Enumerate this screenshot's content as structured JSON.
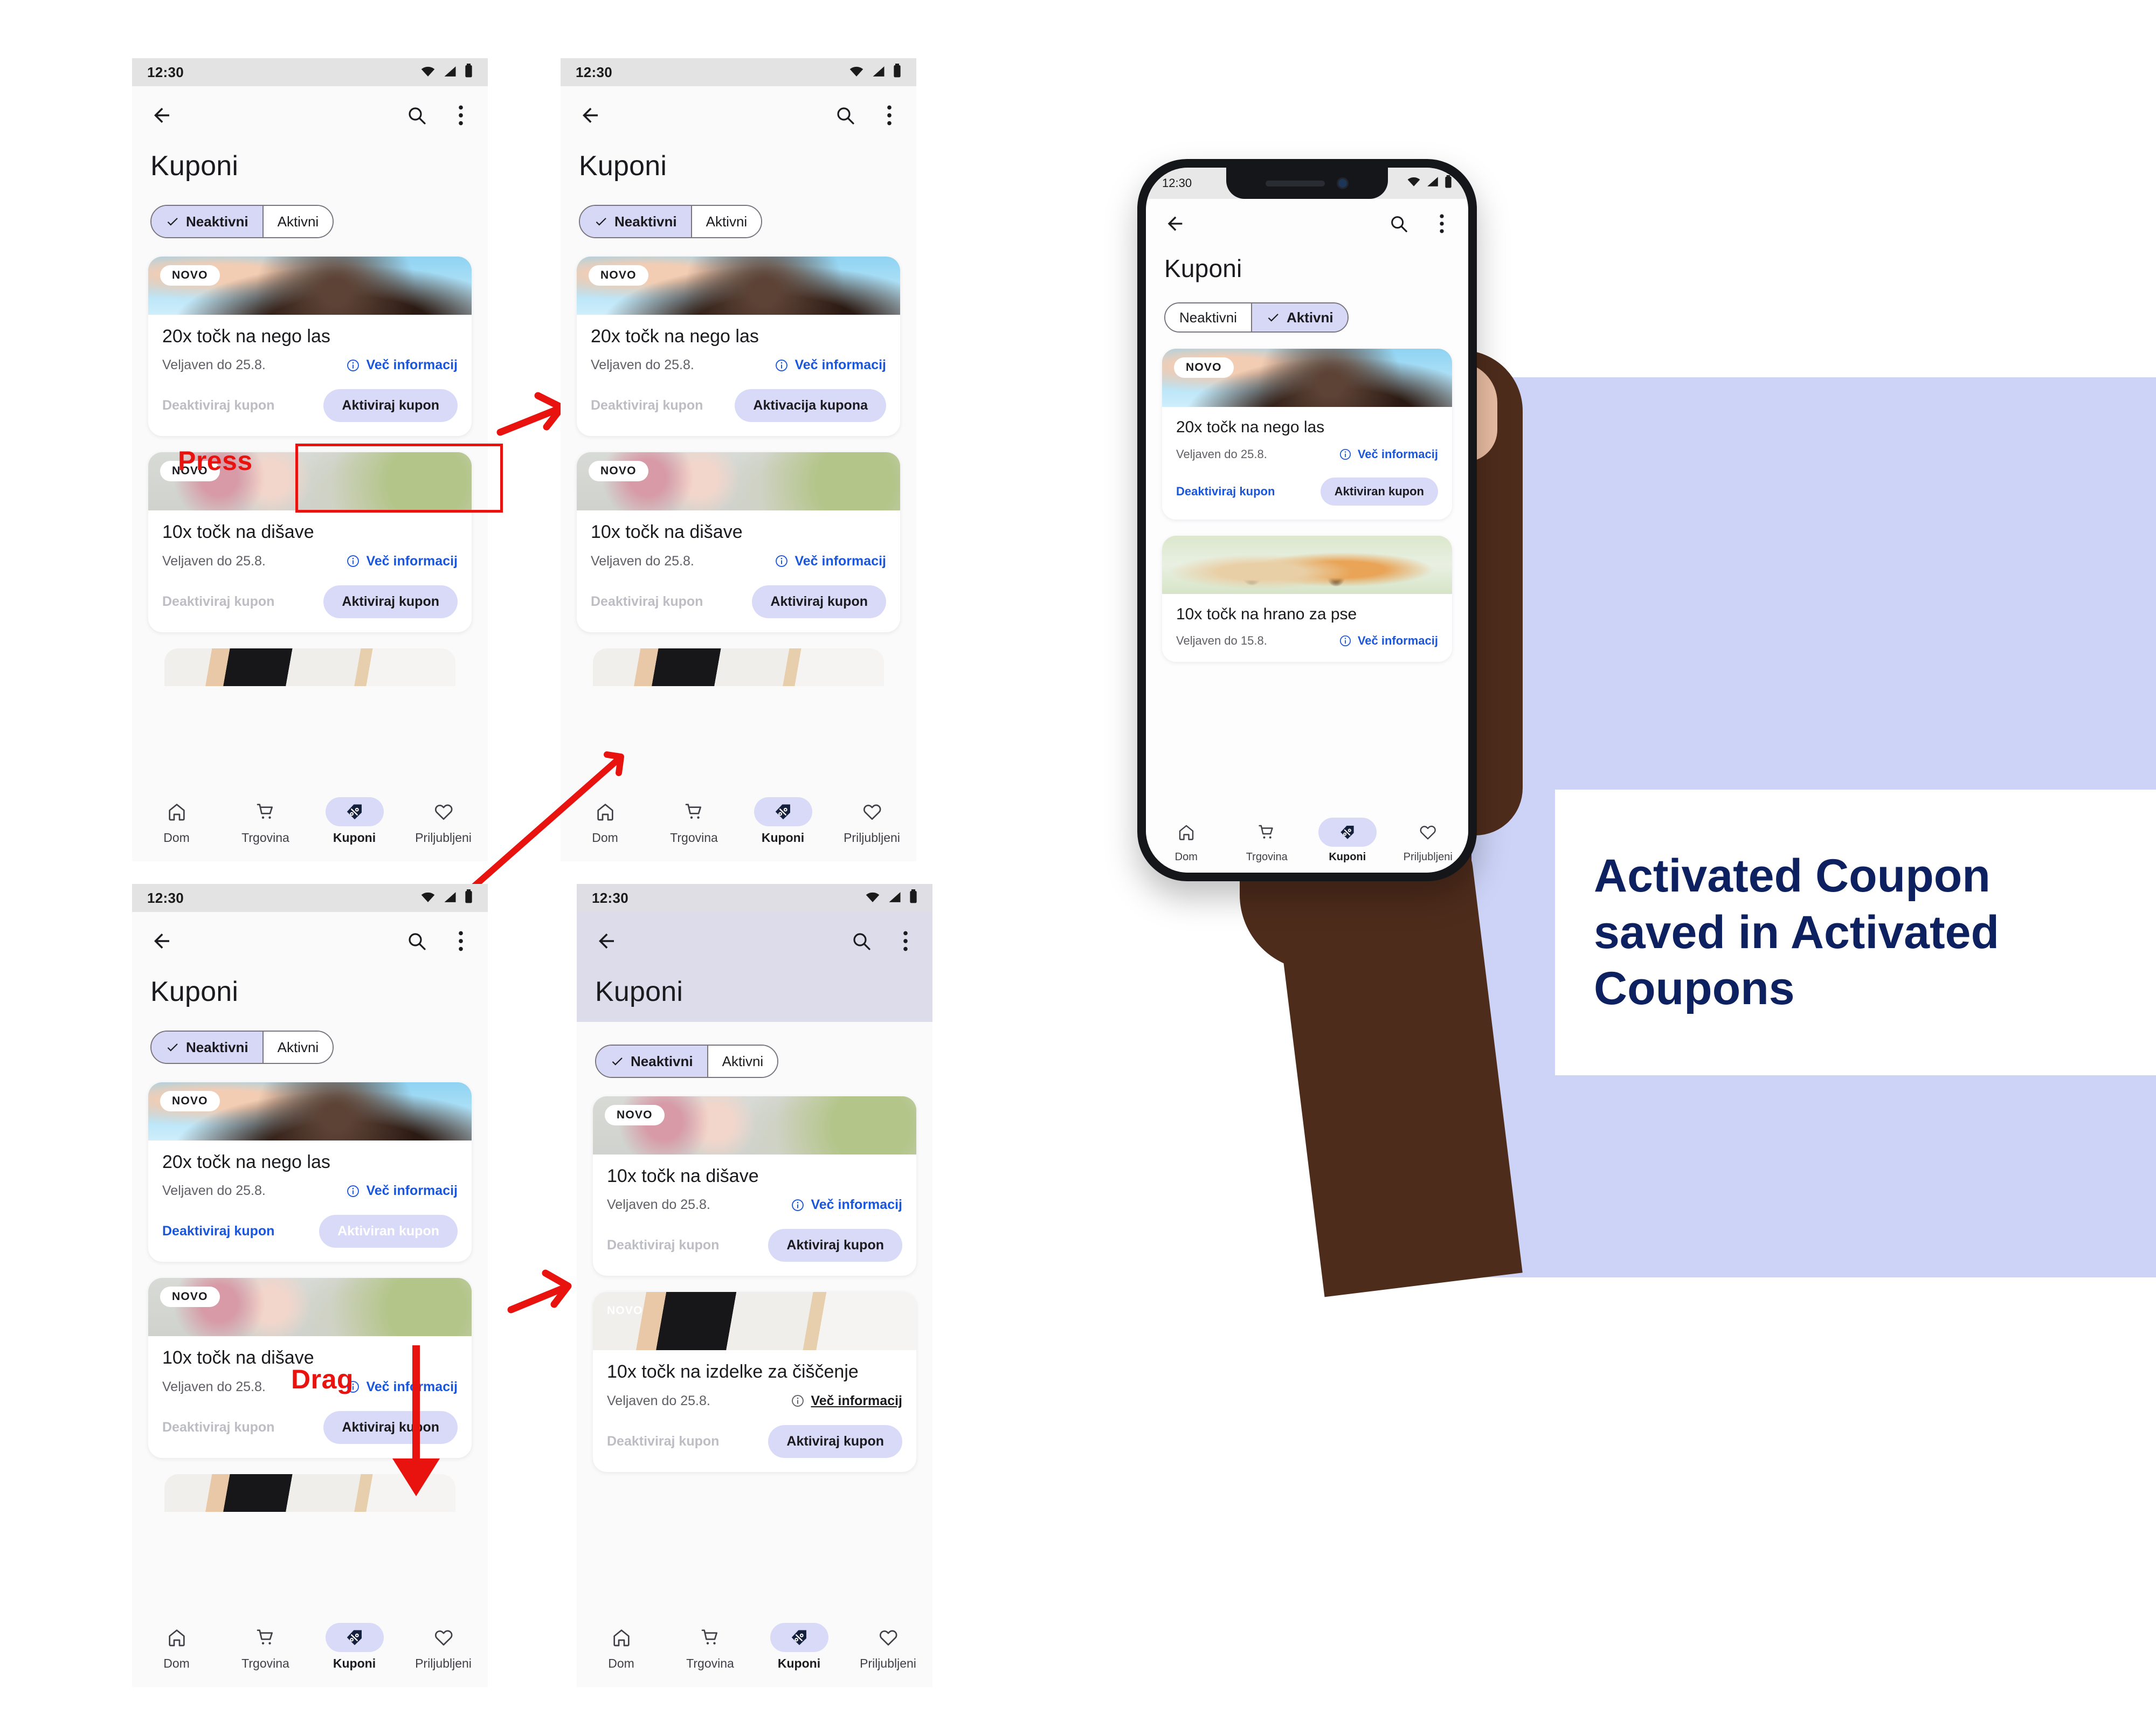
{
  "status_bar": {
    "time": "12:30",
    "icons": [
      "wifi-icon",
      "signal-icon",
      "battery-icon"
    ]
  },
  "app_bar": {
    "back": "back-arrow-icon",
    "search": "search-icon",
    "menu": "overflow-menu-icon"
  },
  "screen": {
    "title": "Kuponi"
  },
  "segmented": {
    "inactive": "Neaktivni",
    "active": "Aktivni"
  },
  "badges": {
    "novo": "NOVO"
  },
  "labels": {
    "valid_25": "Veljaven do 25.8.",
    "valid_15": "Veljaven do 15.8.",
    "more_info": "Več informacij",
    "deactivate": "Deaktiviraj kupon",
    "activate": "Aktiviraj kupon",
    "activating": "Aktivacija kupona",
    "activated": "Aktiviran kupon"
  },
  "coupons": {
    "hair": "20x točk na nego las",
    "fragrance": "10x točk na dišave",
    "cleaning": "10x točk na izdelke za čiščenje",
    "dogfood": "10x točk na hrano za pse"
  },
  "bottom_nav": {
    "items": [
      {
        "label": "Dom",
        "icon": "home-icon",
        "selected": false
      },
      {
        "label": "Trgovina",
        "icon": "shopping-cart-icon",
        "selected": false
      },
      {
        "label": "Kuponi",
        "icon": "discount-tag-icon",
        "selected": true
      },
      {
        "label": "Priljubljeni",
        "icon": "heart-icon",
        "selected": false
      }
    ]
  },
  "annotations": {
    "press": "Press",
    "drag": "Drag"
  },
  "caption": {
    "line1": "Activated Coupon",
    "line2": "saved in Activated",
    "line3": "Coupons"
  },
  "colors": {
    "accent_lilac": "#d8daf8",
    "link_blue": "#1a56db",
    "annotation_red": "#e8130f",
    "caption_navy": "#0d2060",
    "background_lilac": "#ccd3f7"
  }
}
